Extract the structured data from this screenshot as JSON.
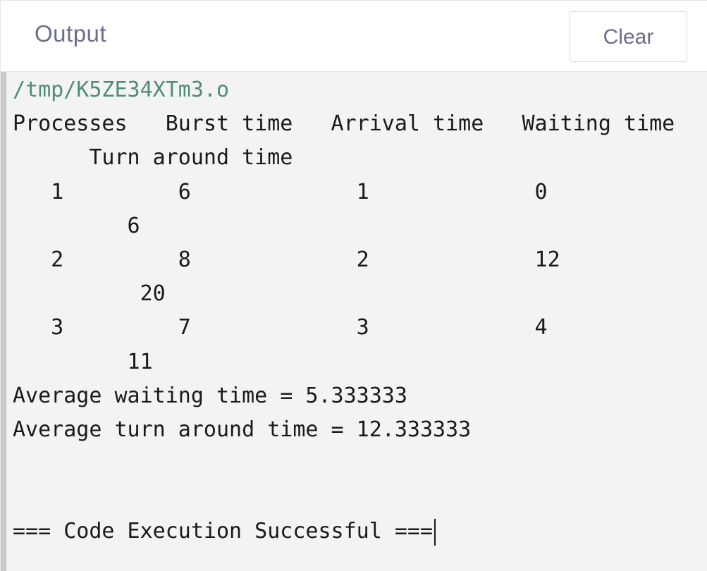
{
  "header": {
    "title": "Output",
    "clear_label": "Clear"
  },
  "console": {
    "lines": [
      "/tmp/K5ZE34XTm3.o",
      "Processes   Burst time   Arrival time   Waiting time",
      "      Turn around time",
      "   1         6             1             0",
      "         6",
      "   2         8             2             12",
      "          20",
      "   3         7             3             4",
      "         11",
      "Average waiting time = 5.333333",
      "Average turn around time = 12.333333",
      "",
      "",
      "=== Code Execution Successful ==="
    ]
  },
  "colors": {
    "title_text": "#6b6e89",
    "path_text": "#4f8d7a",
    "console_bg": "#f3f3f3",
    "console_border": "#c9c9c9",
    "console_text": "#1a1a1a"
  }
}
